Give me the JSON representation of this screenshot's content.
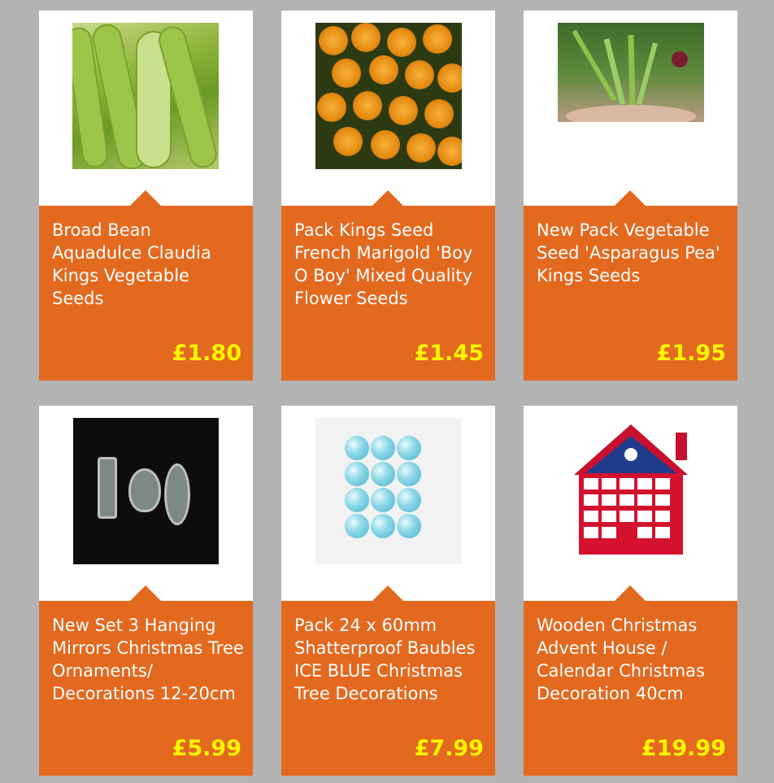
{
  "products": [
    {
      "title": "Broad Bean Aquadulce Claudia Kings Vegetable Seeds",
      "price": "£1.80",
      "image": "broad-bean-pods-photo"
    },
    {
      "title": "Pack Kings Seed French Marigold 'Boy O Boy' Mixed Quality Flower Seeds",
      "price": "£1.45",
      "image": "marigold-flowers-photo"
    },
    {
      "title": "New Pack Vegetable Seed 'Asparagus Pea' Kings Seeds",
      "price": "£1.95",
      "image": "asparagus-pea-photo"
    },
    {
      "title": "New Set 3 Hanging Mirrors Christmas Tree Ornaments/ Decorations 12-20cm",
      "price": "£5.99",
      "image": "hanging-mirrors-photo"
    },
    {
      "title": "Pack 24 x 60mm Shatterproof Baubles ICE BLUE Christmas Tree Decorations",
      "price": "£7.99",
      "image": "ice-blue-baubles-photo"
    },
    {
      "title": "Wooden Christmas Advent House / Calendar Christmas Decoration 40cm",
      "price": "£19.99",
      "image": "advent-house-photo"
    }
  ],
  "colors": {
    "page_bg": "#b3b3b3",
    "panel": "#e3691f",
    "price": "#fff500",
    "title": "#ffffff"
  }
}
